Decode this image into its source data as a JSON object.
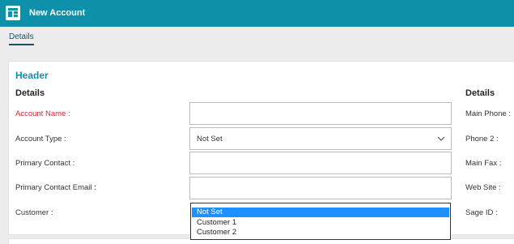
{
  "app": {
    "title": "New Account"
  },
  "tabs": [
    {
      "label": "Details"
    }
  ],
  "header": {
    "title": "Header",
    "left_section": "Details",
    "right_section": "Details"
  },
  "left_fields": [
    {
      "label": "Account Name :",
      "required": true
    },
    {
      "label": "Account Type :",
      "value": "Not Set"
    },
    {
      "label": "Primary Contact :"
    },
    {
      "label": "Primary Contact Email :"
    },
    {
      "label": "Customer :"
    }
  ],
  "right_fields": [
    {
      "label": "Main Phone :"
    },
    {
      "label": "Phone 2 :"
    },
    {
      "label": "Main Fax :"
    },
    {
      "label": "Web Site :"
    },
    {
      "label": "Sage ID :"
    }
  ],
  "customer_dropdown": {
    "options": [
      "Not Set",
      "Customer 1",
      "Customer 2"
    ],
    "selected": "Not Set"
  },
  "colors": {
    "brand": "#0f90aa",
    "required": "#d8252f",
    "selection": "#1e90ff"
  }
}
